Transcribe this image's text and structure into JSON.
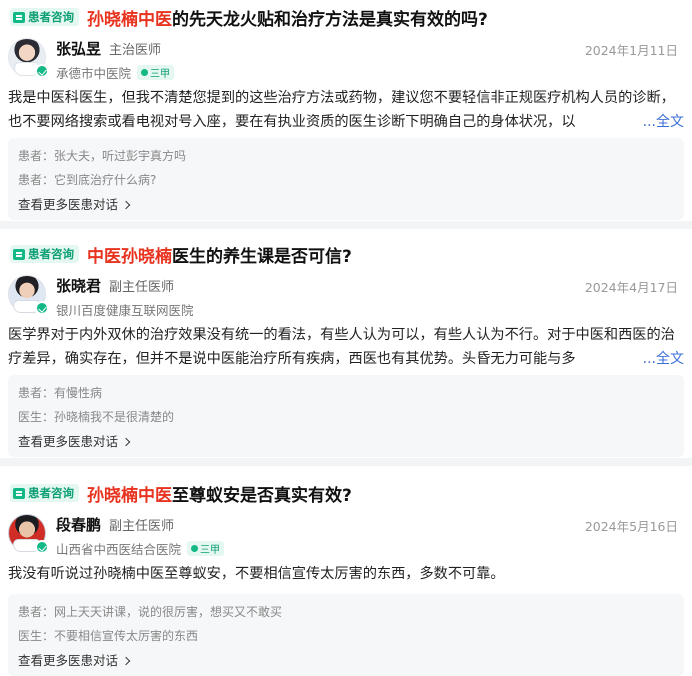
{
  "badge_label": "患者咨询",
  "cards": [
    {
      "title_highlight": "孙晓楠中医",
      "title_rest": "的先天龙火贴和治疗方法是真实有效的吗?",
      "doctor": {
        "name": "张弘昱",
        "title": "主治医师",
        "hospital": "承德市中医院",
        "level": "三甲"
      },
      "date": "2024年1月11日",
      "answer": "我是中医科医生，但我不清楚您提到的这些治疗方法或药物，建议您不要轻信非正规医疗机构人员的诊断，也不要网络搜索或看电视对号入座，要在有执业资质的医生诊断下明确自己的身体状况，以",
      "full_label": "...全文",
      "dialog": [
        "患者：张大夫，听过彭宇真方吗",
        "患者：它到底治疗什么病?"
      ],
      "more_label": "查看更多医患对话"
    },
    {
      "title_highlight": "中医孙晓楠",
      "title_rest": "医生的养生课是否可信?",
      "doctor": {
        "name": "张晓君",
        "title": "副主任医师",
        "hospital": "银川百度健康互联网医院",
        "level": ""
      },
      "date": "2024年4月17日",
      "answer": "医学界对于内外双休的治疗效果没有统一的看法，有些人认为可以，有些人认为不行。对于中医和西医的治疗差异，确实存在，但并不是说中医能治疗所有疾病，西医也有其优势。头昏无力可能与多",
      "full_label": "...全文",
      "dialog": [
        "患者：有慢性病",
        "医生：孙晓楠我不是很清楚的"
      ],
      "more_label": "查看更多医患对话"
    },
    {
      "title_highlight": "孙晓楠中医",
      "title_rest": "至尊蚁安是否真实有效?",
      "doctor": {
        "name": "段春鹏",
        "title": "副主任医师",
        "hospital": "山西省中西医结合医院",
        "level": "三甲"
      },
      "date": "2024年5月16日",
      "answer": "我没有听说过孙晓楠中医至尊蚁安，不要相信宣传太厉害的东西，多数不可靠。",
      "full_label": "",
      "dialog": [
        "患者：网上天天讲课，说的很厉害，想买又不敢买",
        "医生：不要相信宣传太厉害的东西"
      ],
      "more_label": "查看更多医患对话"
    }
  ],
  "colors": {
    "accent_green": "#12b886",
    "highlight_red": "#e8331f",
    "link_blue": "#3b6fd8"
  },
  "icons": {
    "badge": "chat-bubble-icon",
    "verified": "verified-check-icon",
    "more": "chevron-right-icon"
  }
}
